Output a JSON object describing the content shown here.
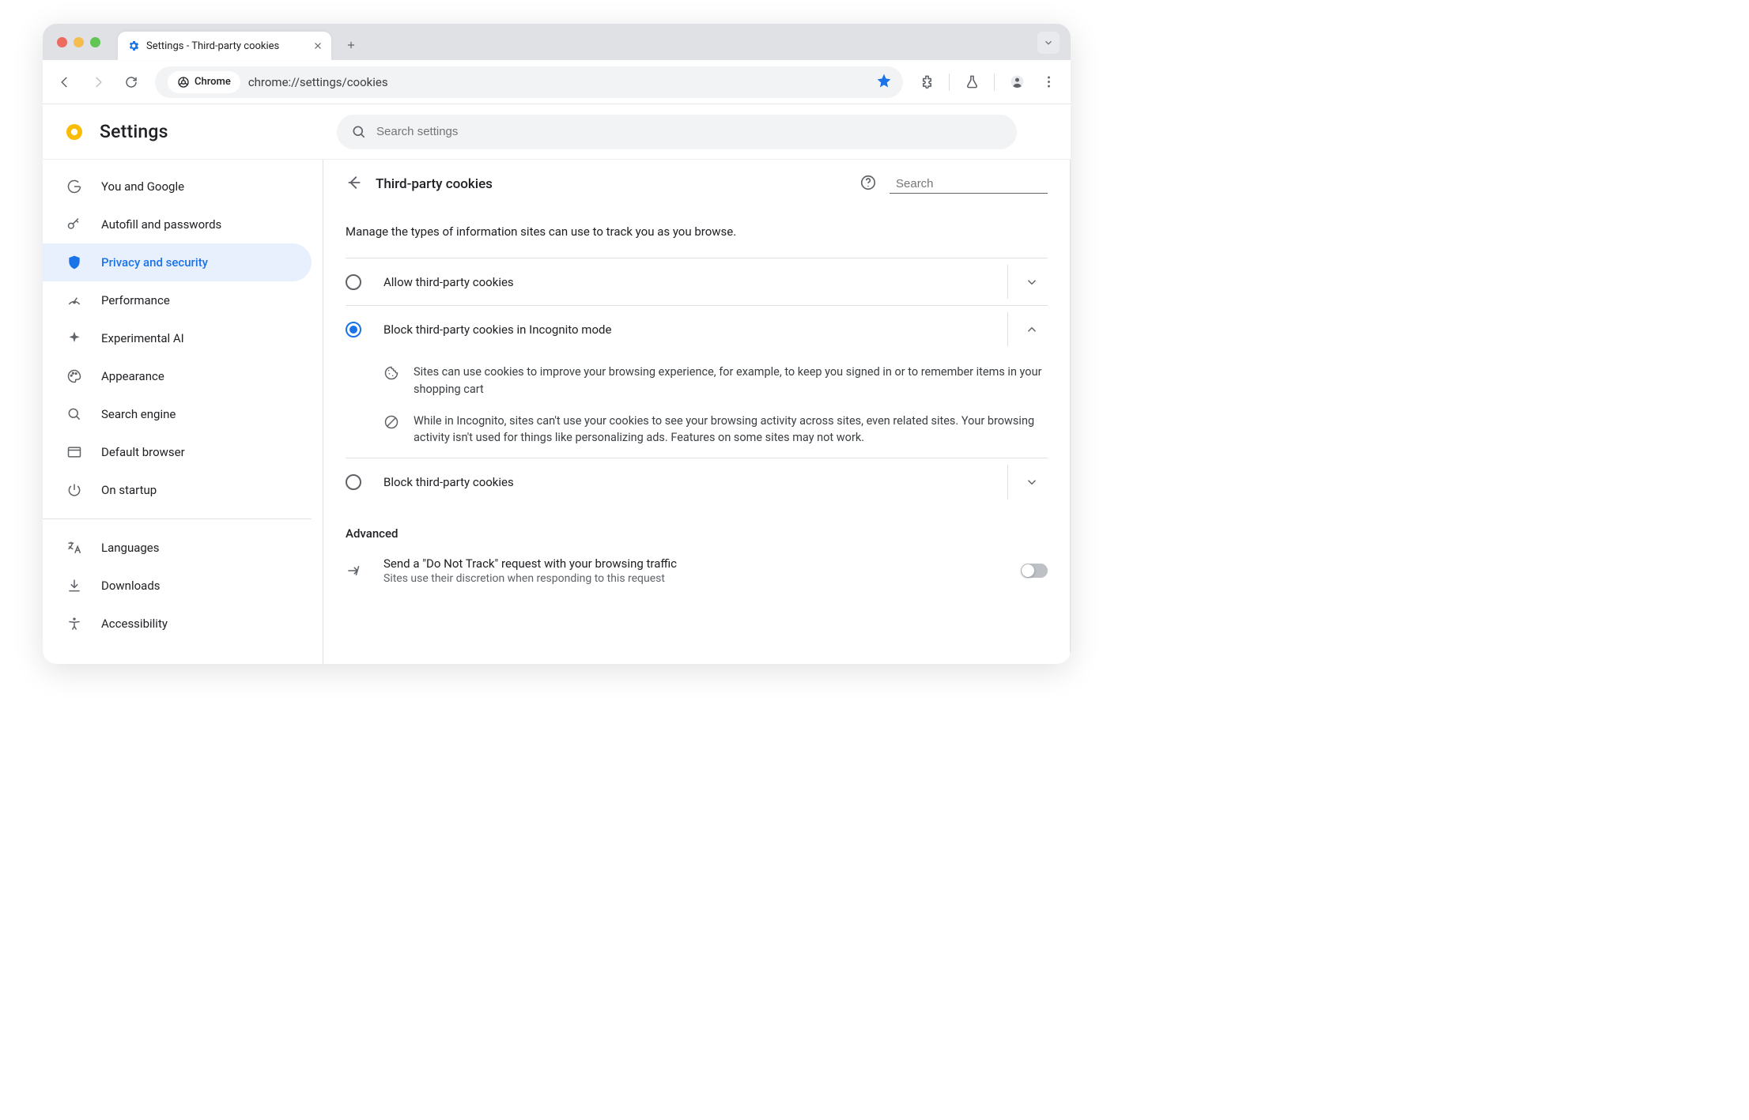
{
  "browser": {
    "tab_title": "Settings - Third-party cookies",
    "omnibox_chip": "Chrome",
    "url": "chrome://settings/cookies"
  },
  "header": {
    "title": "Settings",
    "search_placeholder": "Search settings"
  },
  "sidebar": {
    "items": [
      {
        "label": "You and Google"
      },
      {
        "label": "Autofill and passwords"
      },
      {
        "label": "Privacy and security"
      },
      {
        "label": "Performance"
      },
      {
        "label": "Experimental AI"
      },
      {
        "label": "Appearance"
      },
      {
        "label": "Search engine"
      },
      {
        "label": "Default browser"
      },
      {
        "label": "On startup"
      }
    ],
    "items2": [
      {
        "label": "Languages"
      },
      {
        "label": "Downloads"
      },
      {
        "label": "Accessibility"
      }
    ]
  },
  "main": {
    "title": "Third-party cookies",
    "search_placeholder": "Search",
    "description": "Manage the types of information sites can use to track you as you browse.",
    "options": {
      "allow": "Allow third-party cookies",
      "block_incognito": "Block third-party cookies in Incognito mode",
      "block_all": "Block third-party cookies"
    },
    "detail1": "Sites can use cookies to improve your browsing experience, for example, to keep you signed in or to remember items in your shopping cart",
    "detail2": "While in Incognito, sites can't use your cookies to see your browsing activity across sites, even related sites. Your browsing activity isn't used for things like personalizing ads. Features on some sites may not work.",
    "advanced_label": "Advanced",
    "dnt_title": "Send a \"Do Not Track\" request with your browsing traffic",
    "dnt_sub": "Sites use their discretion when responding to this request"
  }
}
